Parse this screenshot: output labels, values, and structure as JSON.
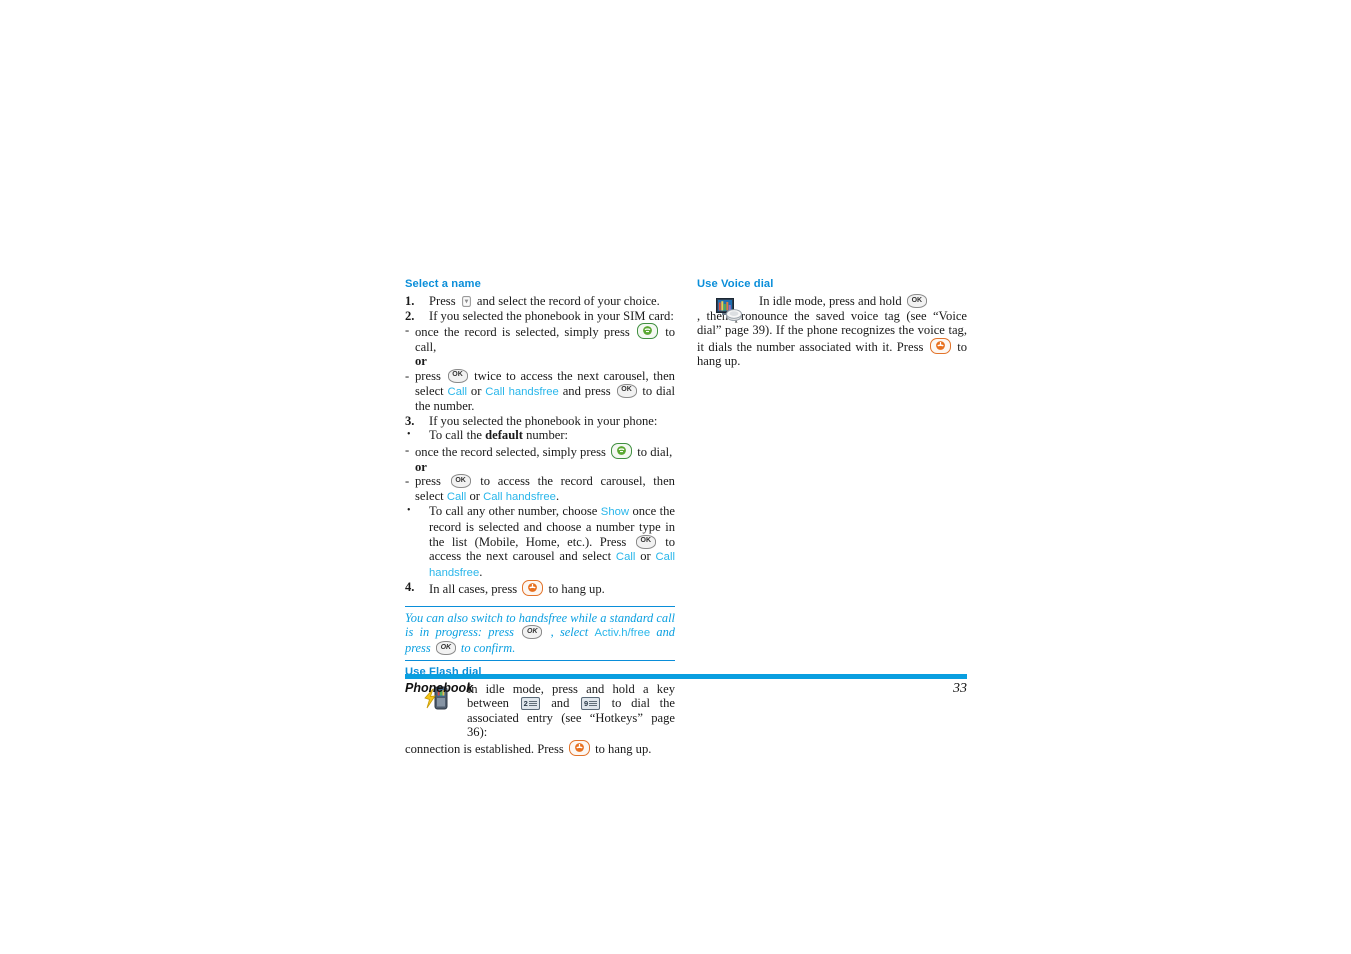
{
  "document": {
    "footer_title": "Phonebook",
    "page_number": "33",
    "accent_color": "#0a9fe0",
    "heading_color": "#0a8ed9",
    "menu_link_color": "#29b6ea"
  },
  "left_column": {
    "section1": {
      "heading": "Select a name",
      "item1": {
        "marker": "1.",
        "text_before": "Press",
        "icon": "nav-down-key-icon",
        "text_after": "and select the record of your choice."
      },
      "item2": {
        "marker": "2.",
        "text": "If you selected the phonebook in your SIM card:"
      },
      "item2a": {
        "marker": "-",
        "text_before": "once the record is selected, simply press",
        "icon": "green-call-key-icon",
        "text_after": "to call,"
      },
      "or1": "or",
      "item2b": {
        "marker": "-",
        "t1": "press",
        "icon1": "ok-key-icon",
        "t2": "twice to access the next carousel, then select",
        "menu1": "Call",
        "t3": "or",
        "menu2": "Call handsfree",
        "t4": "and press",
        "icon2": "ok-key-icon",
        "t5": "to dial the number."
      },
      "item3": {
        "marker": "3.",
        "text": "If you selected the phonebook in your phone:"
      },
      "item3bullet1": {
        "marker": "•",
        "t1": "To call the",
        "bold": "default",
        "t2": "number:"
      },
      "item3a": {
        "marker": "-",
        "text_before": "once the record selected, simply press",
        "icon": "green-call-key-icon",
        "text_after": "to dial,"
      },
      "or2": "or",
      "item3b": {
        "marker": "-",
        "t1": "press",
        "icon1": "ok-key-icon",
        "t2": "to access the record carousel, then select",
        "menu1": "Call",
        "t3": "or",
        "menu2": "Call handsfree",
        "t4": "."
      },
      "item3bullet2": {
        "marker": "•",
        "t1": "To call any other number, choose",
        "menu1": "Show",
        "t2": "once the record is selected and choose a number type in the list (Mobile, Home, etc.). Press",
        "icon1": "ok-key-icon",
        "t3": "to access the next carousel and select",
        "menu2": "Call",
        "t4": "or",
        "menu3": "Call handsfree",
        "t5": "."
      },
      "item4": {
        "marker": "4.",
        "text_before": "In all cases, press",
        "icon": "red-hangup-key-icon",
        "text_after": "to hang up."
      }
    },
    "note": {
      "t1": "You can also switch to handsfree while a standard call is in progress: press",
      "icon1": "ok-key-icon",
      "t2": ", select",
      "menu1": "Activ.h/free",
      "t3": "and press",
      "icon2": "ok-key-icon",
      "t4": "to confirm."
    },
    "section2": {
      "heading": "Use Flash dial",
      "icon": "flash-dial-phone-icon",
      "t1": "In idle mode, press and hold a key between",
      "key1": "2",
      "t2": "and",
      "key2": "9",
      "t3": "to dial the associated entry (see “Hotkeys” page 36):",
      "t4": "connection is established. Press",
      "icon2": "red-hangup-key-icon",
      "t5": "to hang up."
    }
  },
  "right_column": {
    "section1": {
      "heading": "Use Voice dial",
      "icon": "voice-dial-icon",
      "t1": "In idle mode, press and hold",
      "icon1": "ok-key-icon",
      "t2": ", then pronounce the saved voice tag (see “Voice dial” page 39). If the phone recognizes the voice tag, it dials the number associated with it. Press",
      "icon2": "red-hangup-key-icon",
      "t3": "to hang up."
    }
  }
}
